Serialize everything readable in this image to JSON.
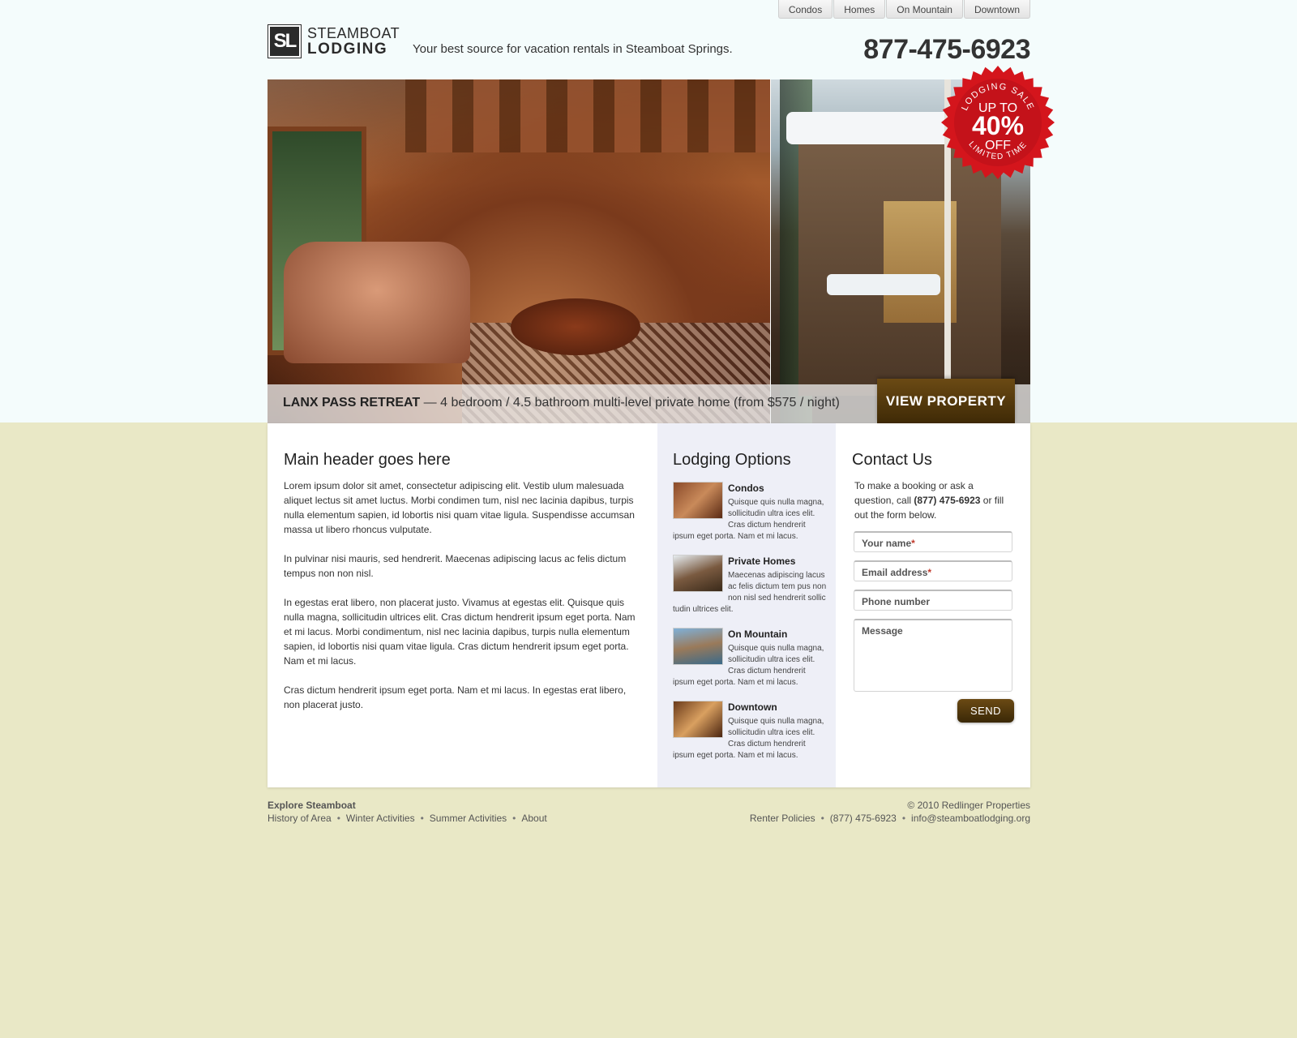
{
  "nav": {
    "tabs": [
      "Condos",
      "Homes",
      "On Mountain",
      "Downtown"
    ]
  },
  "header": {
    "logo_mark": "SL",
    "logo_line1": "STEAMBOAT",
    "logo_line2": "LODGING",
    "tagline": "Your best source for vacation rentals in Steamboat Springs.",
    "phone": "877-475-6923"
  },
  "badge": {
    "top_text": "LODGING SALE",
    "line1": "UP TO",
    "line2": "40%",
    "line3": "OFF",
    "bottom_text": "LIMITED TIME",
    "color": "#d4151c"
  },
  "hero": {
    "property_name": "LANX PASS RETREAT",
    "property_desc": " — 4 bedroom / 4.5 bathroom multi-level private home (from $575 / night)",
    "cta_label": "VIEW PROPERTY"
  },
  "main": {
    "heading": "Main header goes here",
    "paragraphs": [
      "Lorem ipsum dolor sit amet, consectetur adipiscing elit. Vestib ulum malesuada aliquet lectus sit amet luctus. Morbi condimen tum, nisl nec lacinia dapibus, turpis nulla elementum sapien, id lobortis nisi quam vitae ligula. Suspendisse accumsan massa ut libero rhoncus vulputate.",
      "In pulvinar nisi mauris, sed hendrerit. Maecenas adipiscing lacus ac felis dictum tempus non non nisl.",
      "In egestas erat libero, non placerat justo. Vivamus at egestas elit. Quisque quis nulla magna, sollicitudin ultrices elit. Cras dictum hendrerit ipsum eget porta. Nam et mi lacus.   Morbi condimentum, nisl nec lacinia dapibus, turpis nulla elementum sapien, id lobortis nisi quam vitae ligula. Cras dictum hendrerit ipsum eget porta. Nam et mi lacus.",
      "Cras dictum hendrerit ipsum eget porta. Nam et mi lacus. In egestas erat libero, non placerat justo."
    ]
  },
  "lodging": {
    "heading": "Lodging Options",
    "items": [
      {
        "title": "Condos",
        "text": "Quisque quis nulla magna, sollicitudin ultra ices elit. Cras dictum hendrerit ipsum eget porta. Nam et mi lacus."
      },
      {
        "title": "Private Homes",
        "text": "Maecenas adipiscing lacus ac felis dictum tem pus non non nisl sed hendrerit sollic tudin ultrices elit."
      },
      {
        "title": "On Mountain",
        "text": "Quisque quis nulla magna, sollicitudin ultra ices elit. Cras dictum hendrerit ipsum eget porta. Nam et mi lacus."
      },
      {
        "title": "Downtown",
        "text": "Quisque quis nulla magna, sollicitudin ultra ices elit. Cras dictum hendrerit ipsum eget porta. Nam et mi lacus."
      }
    ]
  },
  "contact": {
    "heading": "Contact Us",
    "intro_before": "To make a booking or ask a question, call ",
    "intro_phone": "(877) 475-6923",
    "intro_after": " or fill out the form below.",
    "fields": {
      "name": "Your name",
      "email": "Email address",
      "phone": "Phone number",
      "message": "Message"
    },
    "required_mark": "*",
    "send_label": "SEND"
  },
  "footer": {
    "title": "Explore Steamboat",
    "links": [
      "History of Area",
      "Winter Activities",
      "Summer Activities",
      "About"
    ],
    "copyright": "© 2010 Redlinger Properties",
    "right_links": [
      "Renter Policies",
      "(877) 475-6923",
      "info@steamboatlodging.org"
    ],
    "separator": "•"
  }
}
